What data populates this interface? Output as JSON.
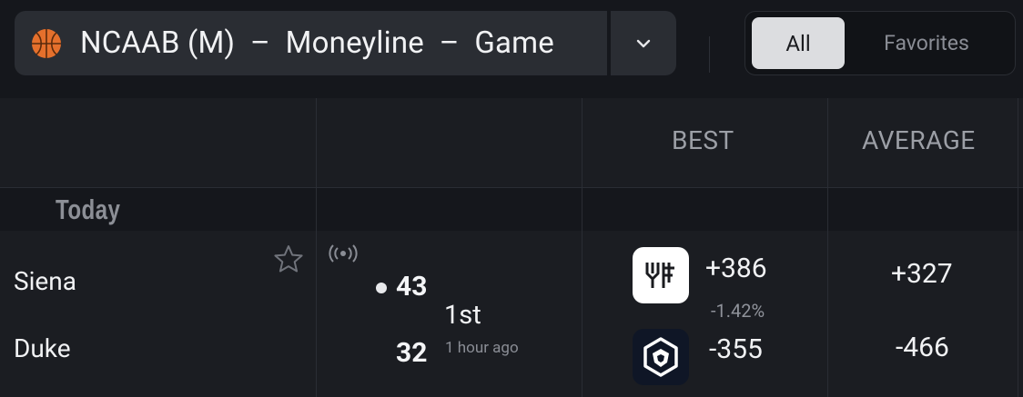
{
  "header": {
    "league_title": "NCAAB (M)  –  Moneyline  –  Game",
    "sport_icon": "basketball-icon",
    "dropdown_icon": "chevron-down-icon",
    "filters": [
      {
        "label": "All",
        "selected": true
      },
      {
        "label": "Favorites",
        "selected": false
      }
    ]
  },
  "table": {
    "columns": [
      "",
      "",
      "BEST",
      "AVERAGE"
    ],
    "section_label": "Today",
    "games": [
      {
        "status_icon": "live-broadcast-icon",
        "period": "1st",
        "time_ago": "1 hour ago",
        "teams": [
          {
            "name": "Siena",
            "score": "43",
            "best_odds": "+386",
            "best_change": "-1.42%",
            "book_icon": "book-logo-yf",
            "average": "+327",
            "possession": true
          },
          {
            "name": "Duke",
            "score": "32",
            "best_odds": "-355",
            "book_icon": "cryptocom-lion-logo",
            "average": "-466",
            "possession": false
          }
        ]
      }
    ]
  },
  "colors": {
    "background": "#15171c",
    "table_bg": "#1b1d22",
    "control_bg": "#2a2d33",
    "selected_pill": "#dcdde0"
  }
}
